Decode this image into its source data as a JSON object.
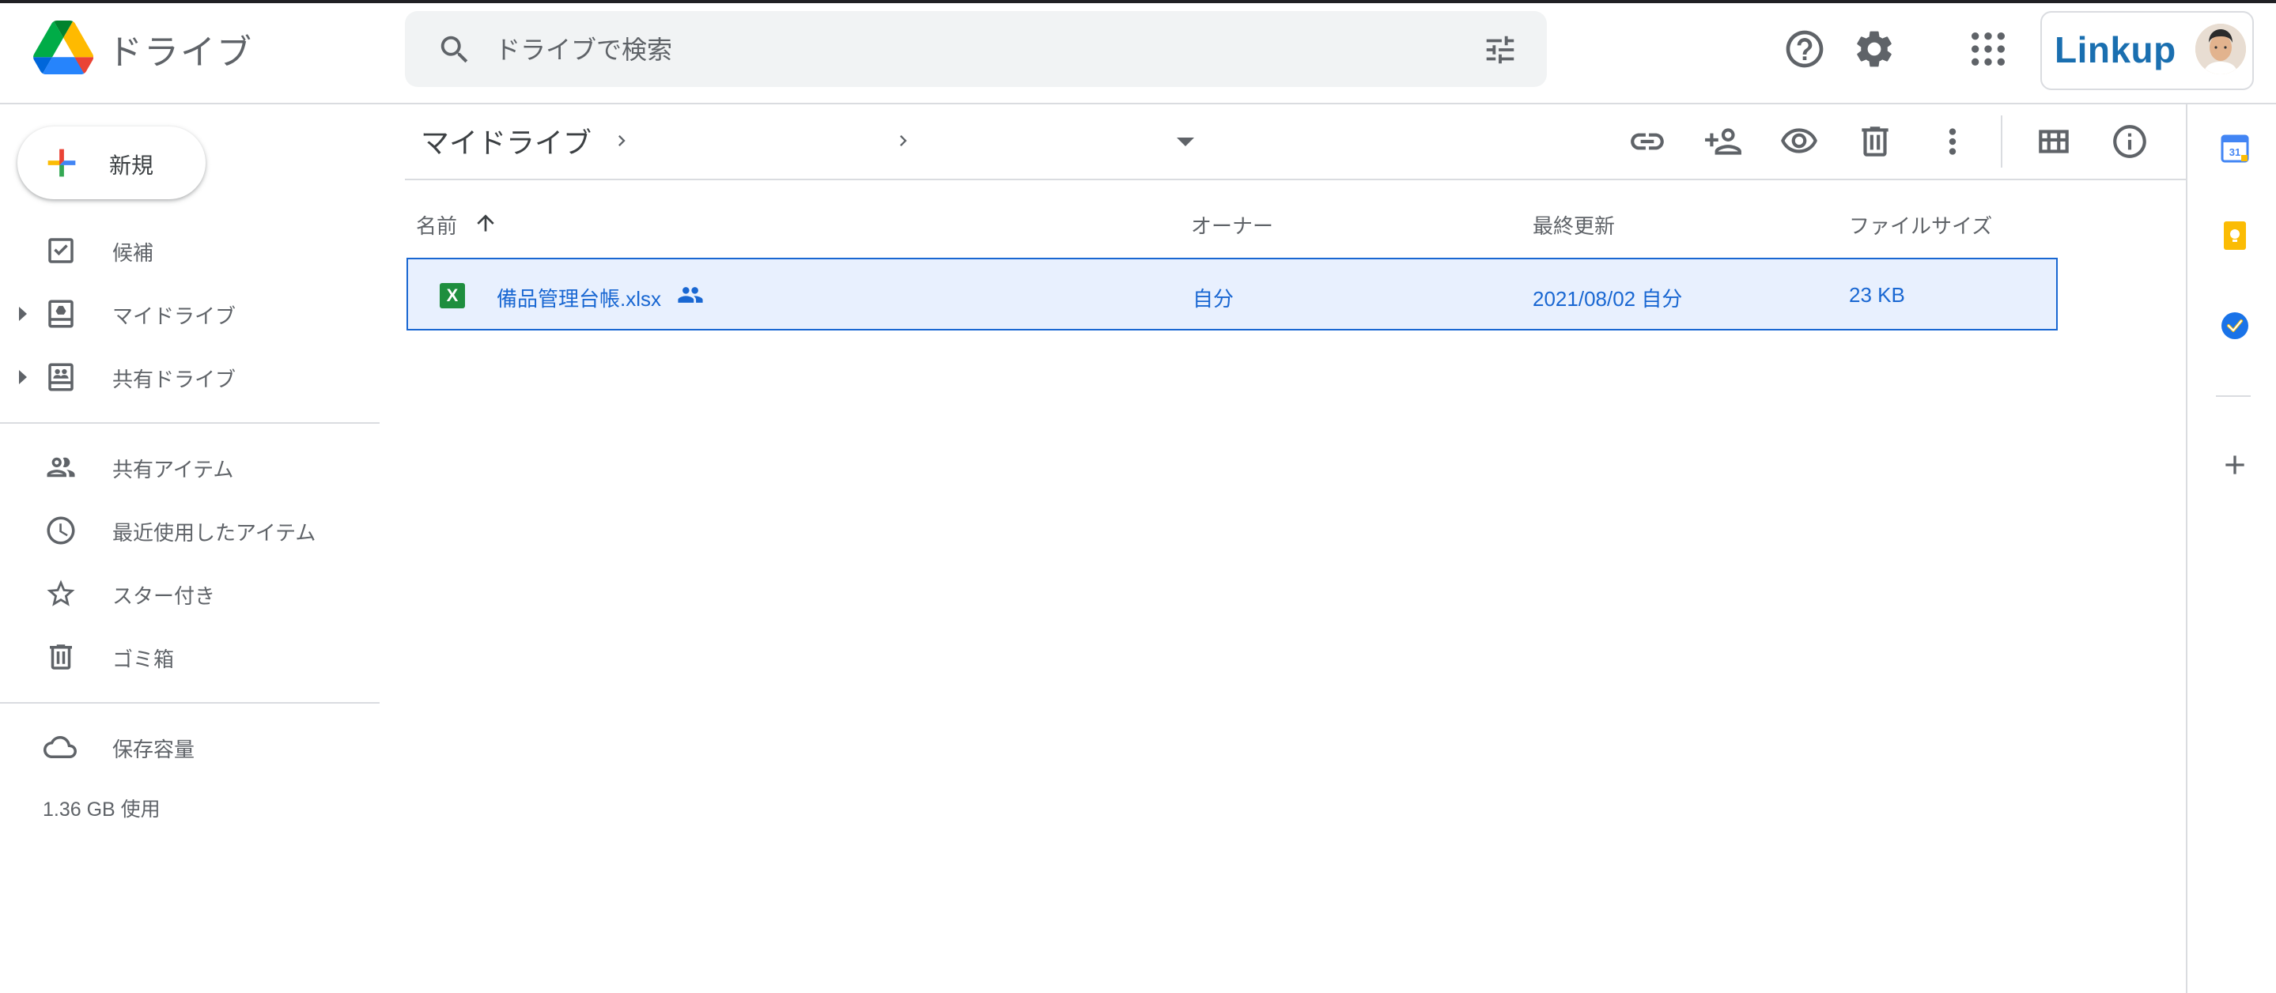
{
  "header": {
    "app_title": "ドライブ",
    "search": {
      "placeholder": "ドライブで検索"
    },
    "account_brand": "Linkup",
    "icons": [
      "drive-logo-icon",
      "search-icon",
      "tune-icon",
      "help-icon",
      "settings-icon",
      "apps-icon"
    ]
  },
  "sidebar": {
    "new_label": "新規",
    "items": [
      {
        "label": "候補",
        "icon": "suggested-icon"
      },
      {
        "label": "マイドライブ",
        "icon": "my-drive-icon"
      },
      {
        "label": "共有ドライブ",
        "icon": "shared-drives-icon"
      },
      {
        "label": "共有アイテム",
        "icon": "shared-with-me-icon"
      },
      {
        "label": "最近使用したアイテム",
        "icon": "recent-icon"
      },
      {
        "label": "スター付き",
        "icon": "star-icon"
      },
      {
        "label": "ゴミ箱",
        "icon": "trash-icon"
      },
      {
        "label": "保存容量",
        "icon": "cloud-icon"
      }
    ],
    "storage_used": "1.36 GB 使用"
  },
  "breadcrumb": {
    "root": "マイドライブ"
  },
  "columns": {
    "name": "名前",
    "owner": "オーナー",
    "modified": "最終更新",
    "size": "ファイルサイズ"
  },
  "files": [
    {
      "name": "備品管理台帳.xlsx",
      "owner": "自分",
      "modified": "2021/08/02 自分",
      "size": "23 KB",
      "type_letter": "X",
      "shared": true,
      "selected": true
    }
  ],
  "toolbar_icons": [
    "link-icon",
    "share-icon",
    "preview-icon",
    "trash-icon",
    "more-vert-icon",
    "grid-view-icon",
    "info-icon"
  ],
  "side_panel_icons": [
    "calendar-icon",
    "keep-icon",
    "tasks-icon",
    "add-icon"
  ],
  "colors": {
    "accent": "#1967d2",
    "selected_bg": "#e8f0fe",
    "excel_green": "#1e8e3e"
  }
}
